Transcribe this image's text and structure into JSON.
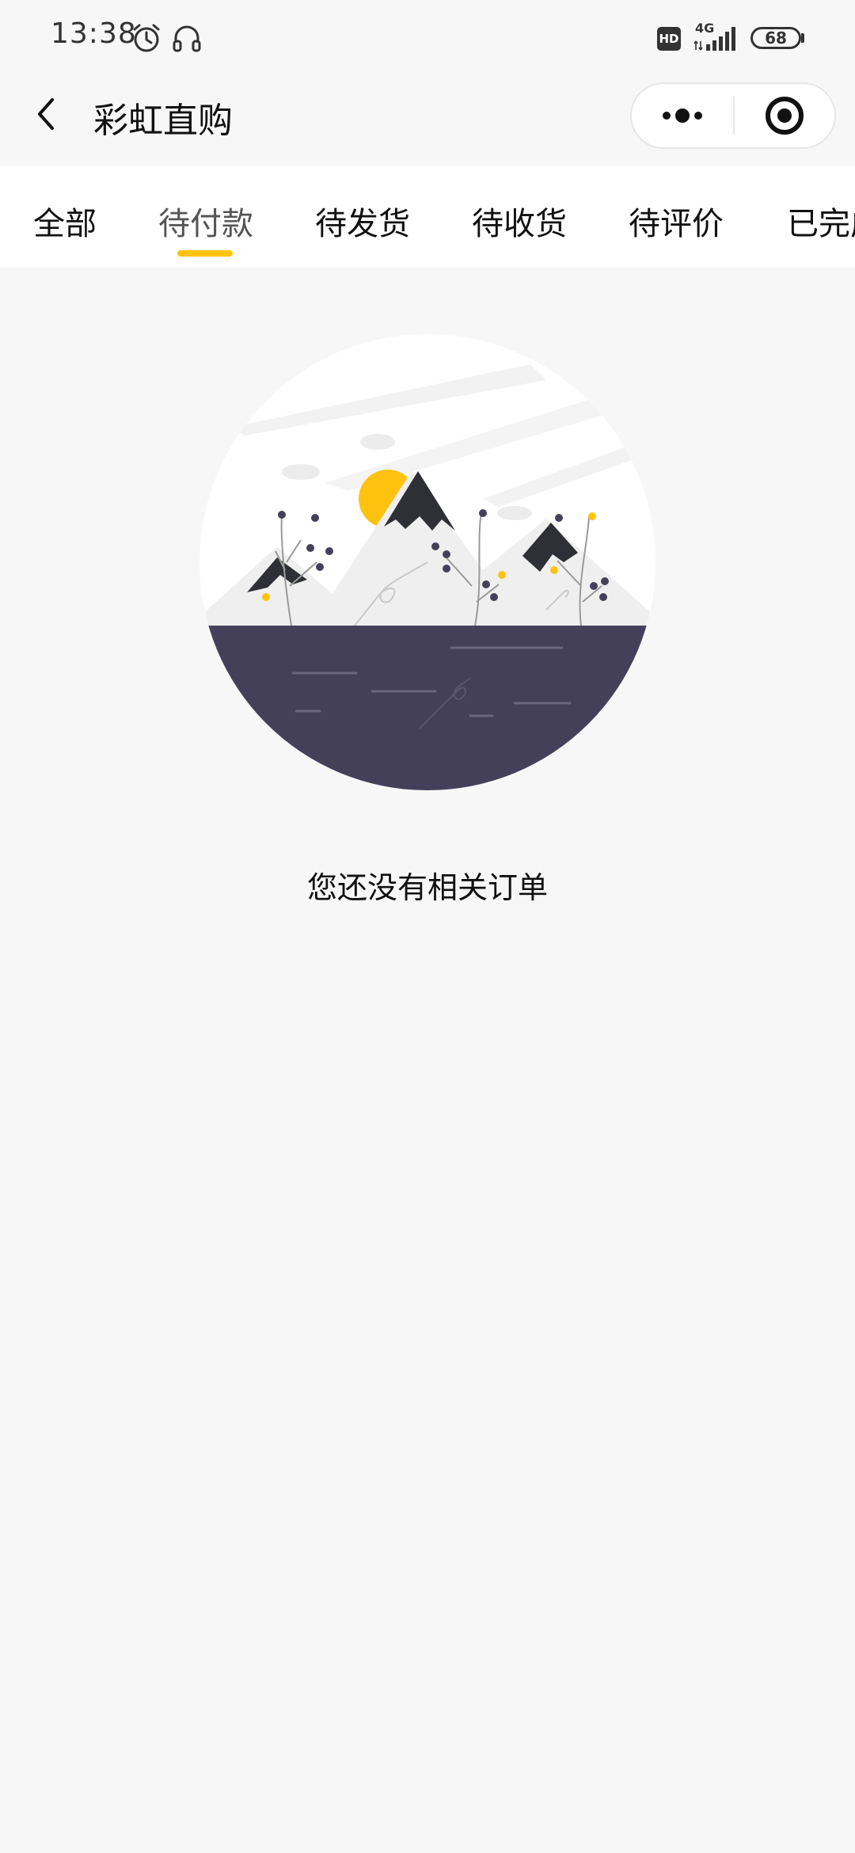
{
  "status_bar": {
    "time": "13:38",
    "hd": "HD",
    "network": "4G",
    "battery": "68"
  },
  "nav": {
    "title": "彩虹直购"
  },
  "tabs": [
    {
      "label": "全部",
      "active": false
    },
    {
      "label": "待付款",
      "active": true
    },
    {
      "label": "待发货",
      "active": false
    },
    {
      "label": "待收货",
      "active": false
    },
    {
      "label": "待评价",
      "active": false
    },
    {
      "label": "已完成",
      "active": false
    }
  ],
  "empty_state": {
    "message": "您还没有相关订单"
  },
  "colors": {
    "accent": "#ffc30f",
    "water": "#45405a",
    "mountain_dark": "#2f2f36",
    "background": "#f7f7f7"
  }
}
